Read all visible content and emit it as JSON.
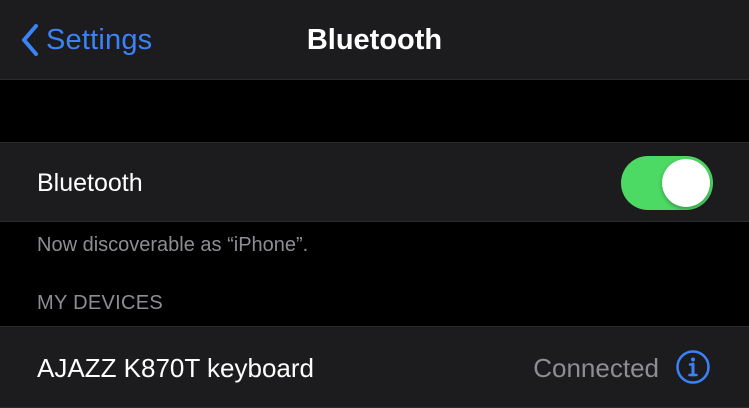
{
  "nav": {
    "back_label": "Settings",
    "title": "Bluetooth"
  },
  "bluetooth_cell": {
    "label": "Bluetooth",
    "toggle_on": true
  },
  "discoverable_note": "Now discoverable as “iPhone”.",
  "my_devices": {
    "header": "MY DEVICES",
    "devices": [
      {
        "name": "AJAZZ K870T keyboard",
        "status": "Connected"
      }
    ]
  },
  "colors": {
    "accent": "#3a82f7",
    "toggle_on": "#4cd964",
    "cell_bg": "#1c1c1e",
    "secondary_text": "#8d8d93"
  },
  "icons": {
    "back": "chevron-left-icon",
    "info": "info-circle-icon"
  }
}
